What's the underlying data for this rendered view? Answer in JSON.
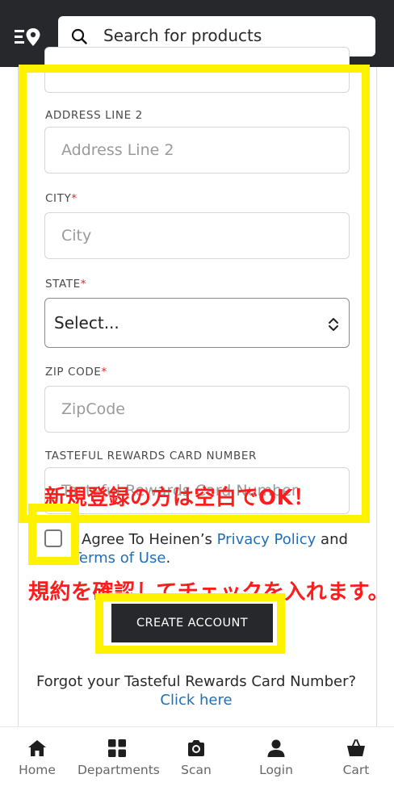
{
  "search": {
    "placeholder": "Search for products"
  },
  "form": {
    "address_line2": {
      "label": "ADDRESS LINE 2",
      "placeholder": "Address Line 2"
    },
    "city": {
      "label": "CITY",
      "placeholder": "City"
    },
    "state": {
      "label": "STATE",
      "value": "Select..."
    },
    "zip": {
      "label": "ZIP CODE",
      "placeholder": "ZipCode"
    },
    "rewards": {
      "label": "TASTEFUL REWARDS CARD NUMBER",
      "placeholder": "Tasteful Rewards Card Number"
    },
    "required_mark": "*",
    "agree": {
      "prefix": "I Agree To Heinen’s ",
      "privacy": "Privacy Policy",
      "and": " and ",
      "terms": "Terms of Use",
      "period": "."
    },
    "create_button": "CREATE ACCOUNT",
    "forgot": {
      "text": "Forgot your Tasteful Rewards Card Number? ",
      "link": "Click here"
    }
  },
  "annotations": {
    "new_registration_note": "新規登録の方は空白でOK！",
    "terms_note": "規約を確認してチェックを入れます。",
    "highlight_color": "#fff200",
    "note_color": "#ff1c1c"
  },
  "bottom_nav": [
    {
      "label": "Home",
      "icon": "home-icon"
    },
    {
      "label": "Departments",
      "icon": "grid-icon"
    },
    {
      "label": "Scan",
      "icon": "camera-icon"
    },
    {
      "label": "Login",
      "icon": "user-icon"
    },
    {
      "label": "Cart",
      "icon": "basket-icon"
    }
  ]
}
